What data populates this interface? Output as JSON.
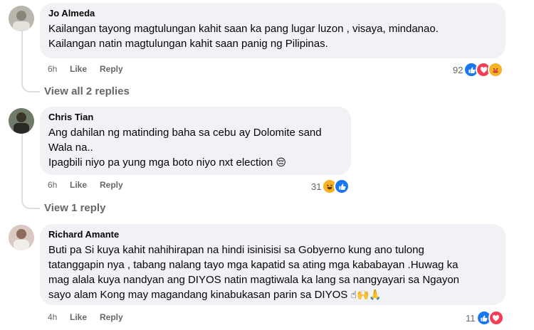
{
  "comments": [
    {
      "author": "Jo Almeda",
      "lines": [
        "Kailangan tayong magtulungan kahit saan ka pang lugar luzon , visaya, mindanao.",
        "Kailangan natin magtulungan kahit saan panig ng Pilipinas."
      ],
      "time": "6h",
      "like_label": "Like",
      "reply_label": "Reply",
      "reaction_count": "92",
      "reaction_icons": [
        "like-icon",
        "love-icon",
        "care-icon"
      ],
      "view_replies": "View all 2 replies"
    },
    {
      "author": "Chris Tian",
      "lines": [
        "Ang dahilan ng matinding baha sa cebu ay Dolomite sand",
        "Wala na..",
        "Ipagbili niyo pa yung mga boto niyo nxt election"
      ],
      "line_emoji": "😔",
      "time": "6h",
      "like_label": "Like",
      "reply_label": "Reply",
      "reaction_count": "31",
      "reaction_icons": [
        "haha-icon",
        "like-icon"
      ],
      "view_replies": "View 1 reply"
    },
    {
      "author": "Richard Amante",
      "lines": [
        "Buti pa Si kuya kahit nahihirapan na hindi isinisisi sa Gobyerno kung ano tulong",
        "tatanggapin nya , tabang nalang tayo mga kapatid sa ating mga kababayan .Huwag ka",
        "mag alala kuya nandyan ang DIYOS natin magtiwala ka lang sa nangyayari sa Ngayon",
        "sayo alam Kong may magandang kinabukasan parin sa DIYOS"
      ],
      "line_emoji": "☝🙌🙏",
      "time": "4h",
      "like_label": "Like",
      "reply_label": "Reply",
      "reaction_count": "11",
      "reaction_icons": [
        "like-icon",
        "love-icon"
      ]
    }
  ],
  "colors": {
    "bubble": "#f0f2f5",
    "meta": "#65676b",
    "like": "#1877f2",
    "love": "#f33e58",
    "haha": "#f7b125"
  }
}
